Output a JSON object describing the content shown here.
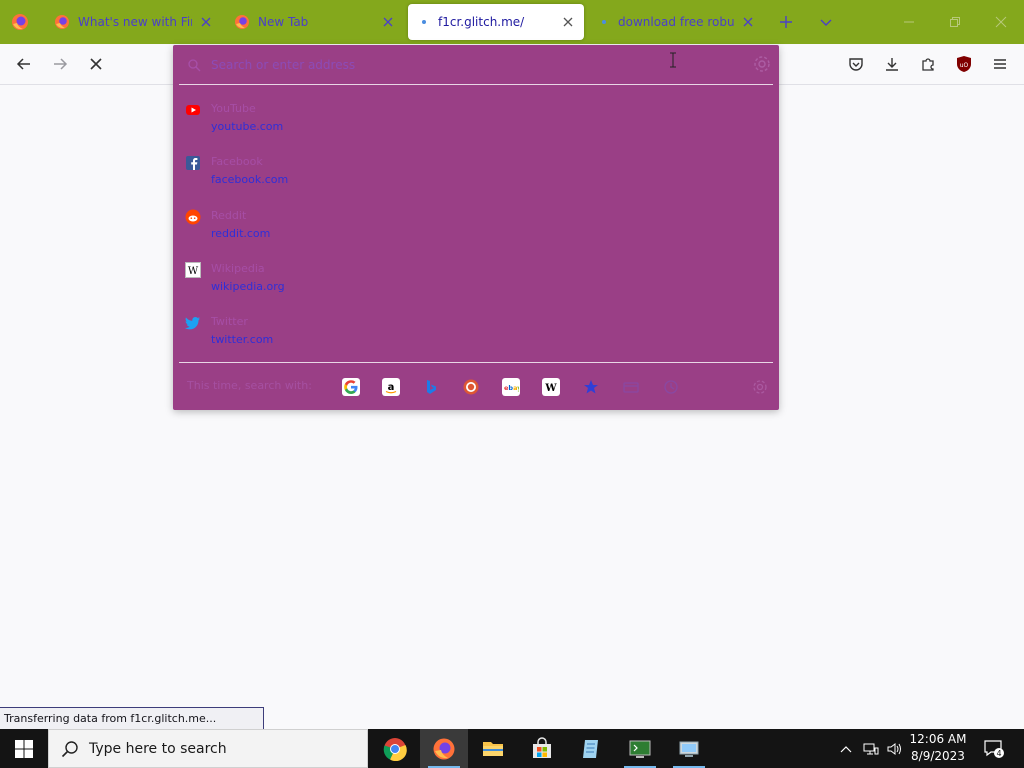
{
  "browser": {
    "tabs": [
      {
        "label": "What's new with Firef",
        "icon": "firefox-icon"
      },
      {
        "label": "New Tab",
        "icon": "firefox-icon"
      },
      {
        "label": "f1cr.glitch.me/",
        "icon": "loading-dot-icon",
        "active": true
      },
      {
        "label": "download free robux",
        "icon": "loading-dot-icon"
      }
    ],
    "close_glyph": "×",
    "accent_color": "#84a81c"
  },
  "urlbar": {
    "placeholder": "Search or enter address",
    "panel_color": "#9a3f86",
    "suggestions": [
      {
        "title": "YouTube",
        "url": "youtube.com",
        "icon": "youtube-icon"
      },
      {
        "title": "Facebook",
        "url": "facebook.com",
        "icon": "facebook-icon"
      },
      {
        "title": "Reddit",
        "url": "reddit.com",
        "icon": "reddit-icon"
      },
      {
        "title": "Wikipedia",
        "url": "wikipedia.org",
        "icon": "wikipedia-icon"
      },
      {
        "title": "Twitter",
        "url": "twitter.com",
        "icon": "twitter-icon"
      }
    ],
    "oneoff_label": "This time, search with:",
    "engines": [
      "google-icon",
      "amazon-icon",
      "bing-icon",
      "duckduckgo-icon",
      "ebay-icon",
      "wikipedia-icon",
      "bookmarks-icon",
      "tabs-icon",
      "history-icon"
    ]
  },
  "status": {
    "text": "Transferring data from f1cr.glitch.me..."
  },
  "taskbar": {
    "search_placeholder": "Type here to search",
    "time": "12:06 AM",
    "date": "8/9/2023",
    "notification_count": "4"
  }
}
